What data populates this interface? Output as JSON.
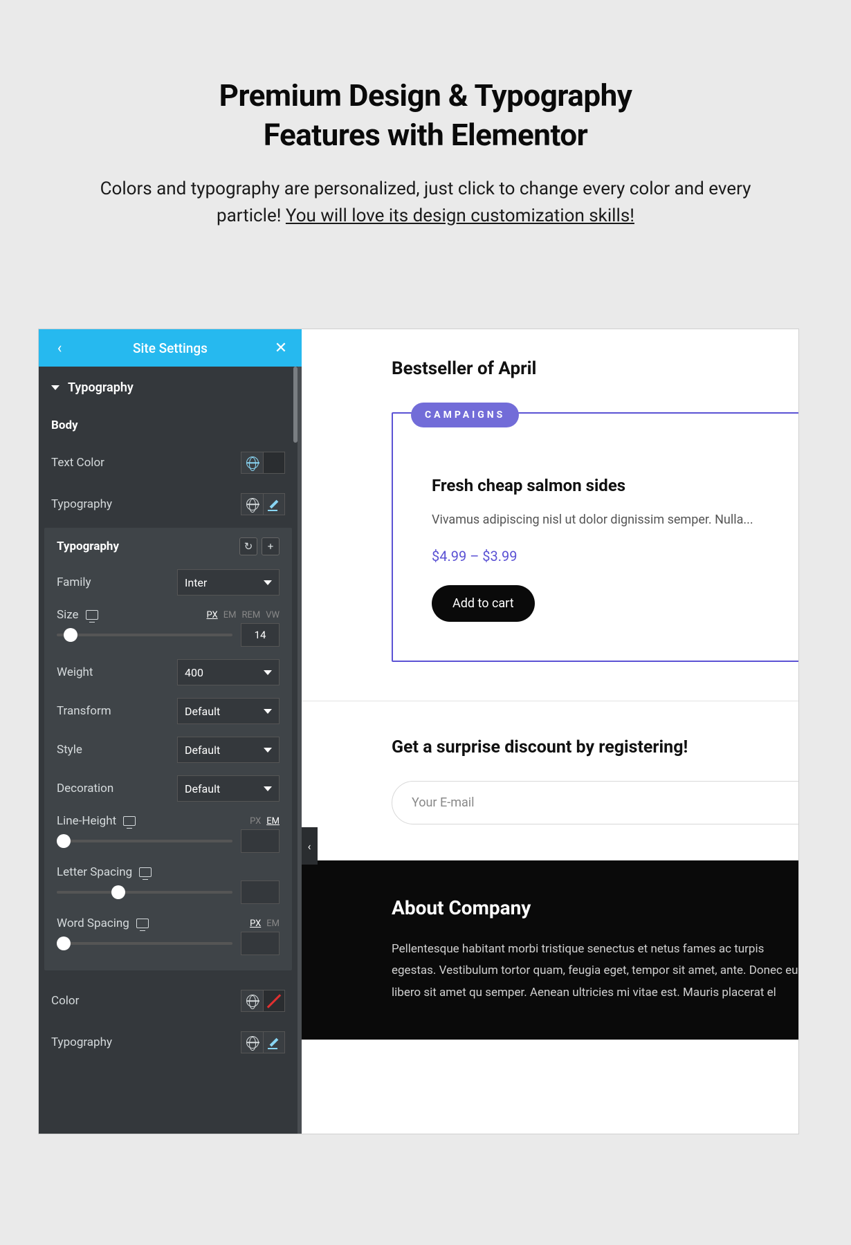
{
  "hero": {
    "title_l1": "Premium Design & Typography",
    "title_l2": "Features with Elementor",
    "desc_a": "Colors and typography are personalized, just click to change every color and every particle! ",
    "desc_b": "You will love its design customization skills!"
  },
  "sidebar": {
    "header_title": "Site Settings",
    "section": "Typography",
    "body_label": "Body",
    "text_color": "Text Color",
    "typography": "Typography",
    "pop_title": "Typography",
    "family": "Family",
    "family_value": "Inter",
    "size": "Size",
    "size_value": "14",
    "size_units": [
      "PX",
      "EM",
      "REM",
      "VW"
    ],
    "size_unit_active": "PX",
    "weight": "Weight",
    "weight_value": "400",
    "transform": "Transform",
    "transform_value": "Default",
    "style": "Style",
    "style_value": "Default",
    "decoration": "Decoration",
    "decoration_value": "Default",
    "line_height": "Line-Height",
    "lh_units": [
      "PX",
      "EM"
    ],
    "lh_unit_active": "EM",
    "letter_spacing": "Letter Spacing",
    "word_spacing": "Word Spacing",
    "ws_units": [
      "PX",
      "EM"
    ],
    "ws_unit_active": "PX",
    "color": "Color",
    "typography2": "Typography"
  },
  "preview": {
    "bestseller": "Bestseller of April",
    "badge": "CAMPAIGNS",
    "card_title": "Fresh cheap salmon sides",
    "card_desc": "Vivamus adipiscing nisl ut dolor dignissim semper. Nulla...",
    "price": "$4.99 – $3.99",
    "add_to_cart": "Add to cart",
    "discount_title": "Get a surprise discount by registering!",
    "email_placeholder": "Your E-mail",
    "about_title": "About Company",
    "about_text": "Pellentesque habitant morbi tristique senectus et netus fames ac turpis egestas. Vestibulum tortor quam, feugia eget, tempor sit amet, ante. Donec eu libero sit amet qu semper. Aenean ultricies mi vitae est. Mauris placerat el"
  }
}
